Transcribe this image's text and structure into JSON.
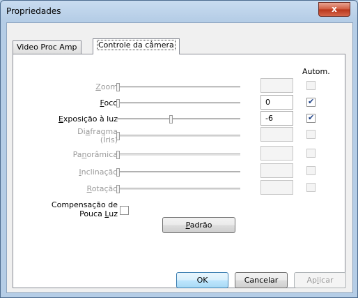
{
  "window": {
    "title": "Propriedades",
    "close_label": "x"
  },
  "tabs": [
    {
      "label": "Video Proc Amp",
      "active": false
    },
    {
      "label": "Controle da câmera",
      "active": true
    }
  ],
  "auto_header": "Autom.",
  "controls": [
    {
      "label": "Zoom",
      "label_u": "Z",
      "label_rest": "oom",
      "enabled": false,
      "value": "",
      "auto": false,
      "level": 0.0
    },
    {
      "label": "Foco",
      "label_u": "F",
      "label_rest": "oco",
      "enabled": true,
      "value": "0",
      "auto": true,
      "level": 0.0
    },
    {
      "label": "Exposição à luz",
      "label_u": "E",
      "label_rest": "xposição à luz",
      "enabled": true,
      "value": "-6",
      "auto": true,
      "level": 0.44
    },
    {
      "label": "Diafragma (Íris)",
      "enabled": false,
      "value": "",
      "auto": false,
      "level": 0.0
    },
    {
      "label": "Panorâmica",
      "enabled": false,
      "value": "",
      "auto": false,
      "level": 0.0
    },
    {
      "label": "Inclinação",
      "enabled": false,
      "value": "",
      "auto": false,
      "level": 0.0
    },
    {
      "label": "Rotação",
      "enabled": false,
      "value": "",
      "auto": false,
      "level": 0.0
    }
  ],
  "labels": {
    "diafragma_line1_a": "Di",
    "diafragma_line1_u": "a",
    "diafragma_line1_b": "fragma",
    "diafragma_line2": "(Íris)",
    "panoramica_a": "Pa",
    "panoramica_u": "n",
    "panoramica_b": "orâmica",
    "inclinacao_u": "I",
    "inclinacao_b": "nclinação",
    "rotacao_u": "R",
    "rotacao_b": "otação",
    "low_light_line1": "Compensação de",
    "low_light_line2_a": "Pouca ",
    "low_light_line2_u": "L",
    "low_light_line2_b": "uz"
  },
  "low_light_checked": false,
  "default_button": {
    "u": "P",
    "rest": "adrão"
  },
  "buttons": {
    "ok": "OK",
    "cancel": "Cancelar",
    "apply_a": "Ap",
    "apply_u": "l",
    "apply_b": "icar"
  }
}
